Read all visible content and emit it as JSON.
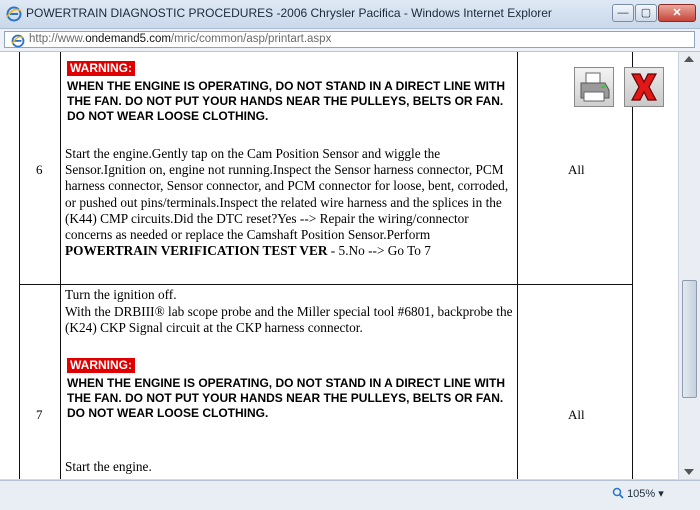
{
  "window": {
    "title": "POWERTRAIN DIAGNOSTIC PROCEDURES -2006 Chrysler Pacifica - Windows Internet Explorer",
    "minimize_label": "—",
    "maximize_label": "▢",
    "close_label": "✕"
  },
  "address": {
    "url_prefix": "http://www.",
    "url_domain": "ondemand5.com",
    "url_path": "/mric/common/asp/printart.aspx"
  },
  "status": {
    "zoom": "105%"
  },
  "warning": {
    "label": "WARNING:",
    "text": "WHEN THE ENGINE IS OPERATING, DO NOT STAND IN A DIRECT LINE WITH THE FAN. DO NOT PUT YOUR HANDS NEAR THE PULLEYS, BELTS OR FAN. DO NOT WEAR LOOSE CLOTHING."
  },
  "rows": [
    {
      "number": "6",
      "applies": "All",
      "procedure_text": "Start the engine.Gently tap on the Cam Position Sensor and wiggle the Sensor.Ignition on, engine not running.Inspect the Sensor harness connector, PCM harness connector, Sensor connector, and PCM connector for loose, bent, corroded, or pushed out pins/terminals.Inspect the related wire harness and the splices in the (K44) CMP circuits.Did the DTC reset?Yes --> Repair the wiring/connector concerns as needed or replace the Camshaft Position Sensor.Perform ",
      "procedure_bold": "POWERTRAIN VERIFICATION TEST VER",
      "procedure_tail": " - 5.No --> Go To 7"
    },
    {
      "number": "7",
      "applies": "All",
      "line1": "Turn the ignition off.",
      "line2": "With the DRBIII® lab scope probe and the Miller special tool #6801, backprobe the (K24) CKP Signal circuit at the CKP harness connector.",
      "line3": "Start the engine."
    }
  ],
  "icons": {
    "print": "printer-icon",
    "close": "red-x-close-icon",
    "app": "ie-icon"
  }
}
